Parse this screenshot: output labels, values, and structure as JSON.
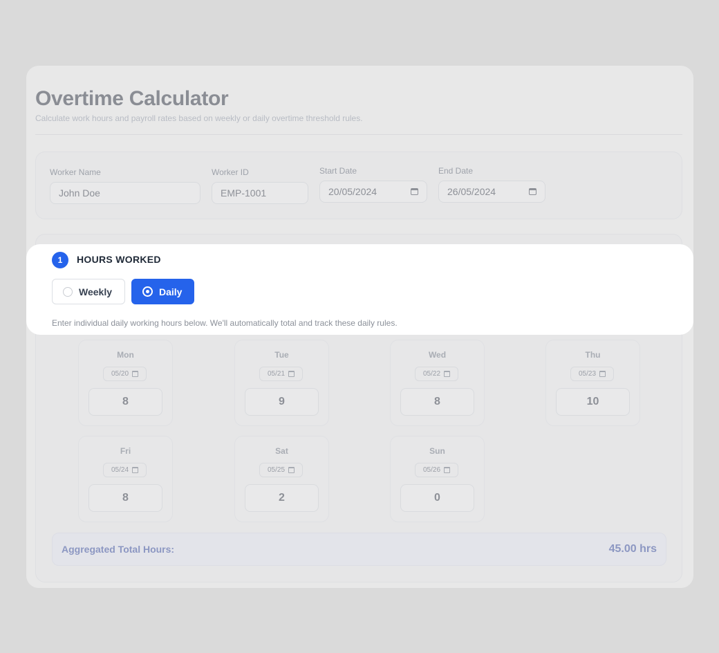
{
  "header": {
    "title": "Overtime Calculator",
    "subtitle": "Calculate work hours and payroll rates based on weekly or daily overtime threshold rules."
  },
  "info": {
    "worker_name": {
      "label": "Worker Name",
      "value": "John Doe"
    },
    "worker_id": {
      "label": "Worker ID",
      "value": "EMP-1001"
    },
    "start_date": {
      "label": "Start Date",
      "value": "20/05/2024"
    },
    "end_date": {
      "label": "End Date",
      "value": "26/05/2024"
    }
  },
  "hours": {
    "step_number": "1",
    "section_title": "HOURS WORKED",
    "mode_options": [
      {
        "label": "Weekly",
        "selected": false
      },
      {
        "label": "Daily",
        "selected": true
      }
    ],
    "helper_text": "Enter individual daily working hours below. We'll automatically total and track these daily rules.",
    "days": [
      {
        "day": "Mon",
        "date": "05/20",
        "hours": "8"
      },
      {
        "day": "Tue",
        "date": "05/21",
        "hours": "9"
      },
      {
        "day": "Wed",
        "date": "05/22",
        "hours": "8"
      },
      {
        "day": "Thu",
        "date": "05/23",
        "hours": "10"
      },
      {
        "day": "Fri",
        "date": "05/24",
        "hours": "8"
      },
      {
        "day": "Sat",
        "date": "05/25",
        "hours": "2"
      },
      {
        "day": "Sun",
        "date": "05/26",
        "hours": "0"
      }
    ],
    "total_label": "Aggregated Total Hours:",
    "total_value": "45.00 hrs"
  },
  "colors": {
    "accent": "#2563eb",
    "background": "#dadada",
    "highlight": "#ffffff"
  }
}
